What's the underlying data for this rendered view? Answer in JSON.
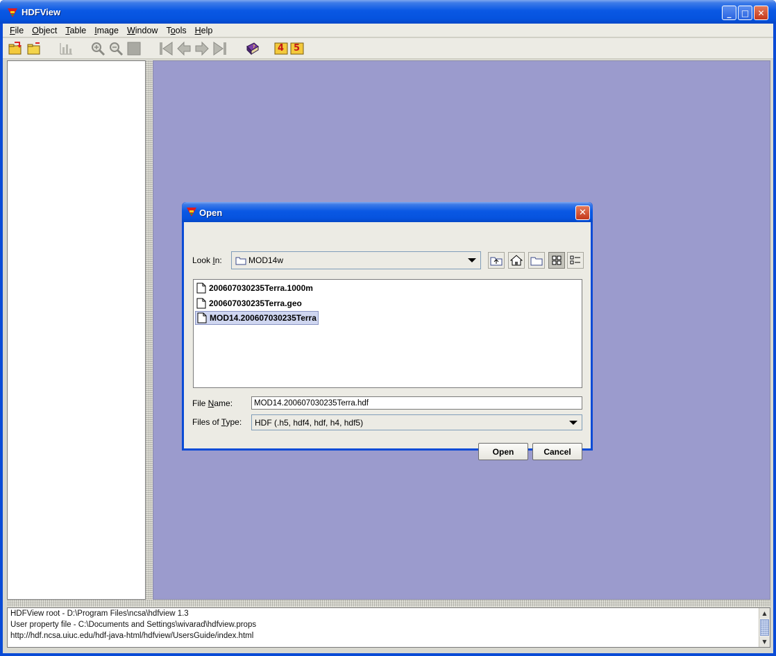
{
  "window": {
    "title": "HDFView",
    "buttons": {
      "minimize": "_",
      "maximize": "□",
      "close": "✕"
    }
  },
  "menubar": {
    "items": [
      {
        "first": "F",
        "rest": "ile"
      },
      {
        "first": "O",
        "rest": "bject"
      },
      {
        "first": "T",
        "rest": "able"
      },
      {
        "first": "I",
        "rest": "mage"
      },
      {
        "first": "W",
        "rest": "indow"
      },
      {
        "first": "",
        "pre": "T",
        "u": "o",
        "post": "ols"
      },
      {
        "first": "H",
        "rest": "elp"
      }
    ]
  },
  "toolbar": {
    "icons": [
      "open-file-icon",
      "open-folder-icon",
      "chart-icon",
      "zoom-in-icon",
      "zoom-out-icon",
      "stop-icon",
      "first-page-icon",
      "previous-page-icon",
      "next-page-icon",
      "last-page-icon",
      "help-book-icon",
      "hdf4-icon",
      "hdf5-icon"
    ],
    "hdf4_label": "4",
    "hdf5_label": "5"
  },
  "status": {
    "lines": [
      "HDFView root - D:\\Program Files\\ncsa\\hdfview 1.3",
      "User property file - C:\\Documents and Settings\\wivarad\\hdfview.props",
      "http://hdf.ncsa.uiuc.edu/hdf-java-html/hdfview/UsersGuide/index.html"
    ]
  },
  "dialog": {
    "title": "Open",
    "look_in": {
      "pre": "Look ",
      "u": "I",
      "post": "n:"
    },
    "look_in_value": "MOD14w",
    "files": [
      {
        "name": "200607030235Terra.1000m",
        "selected": false
      },
      {
        "name": "200607030235Terra.geo",
        "selected": false
      },
      {
        "name": "MOD14.200607030235Terra",
        "selected": true
      }
    ],
    "file_name_label": {
      "pre": "File ",
      "u": "N",
      "post": "ame:"
    },
    "file_name_value": "MOD14.200607030235Terra.hdf",
    "files_of_type_label": {
      "pre": "Files of ",
      "u": "T",
      "post": "ype:"
    },
    "files_of_type_value": "HDF (.h5, hdf4, hdf, h4, hdf5)",
    "open_button": "Open",
    "cancel_button": "Cancel"
  },
  "colors": {
    "title_blue": "#0a58e4",
    "desktop": "#9b9bcd",
    "selection": "#cfd6f0"
  }
}
